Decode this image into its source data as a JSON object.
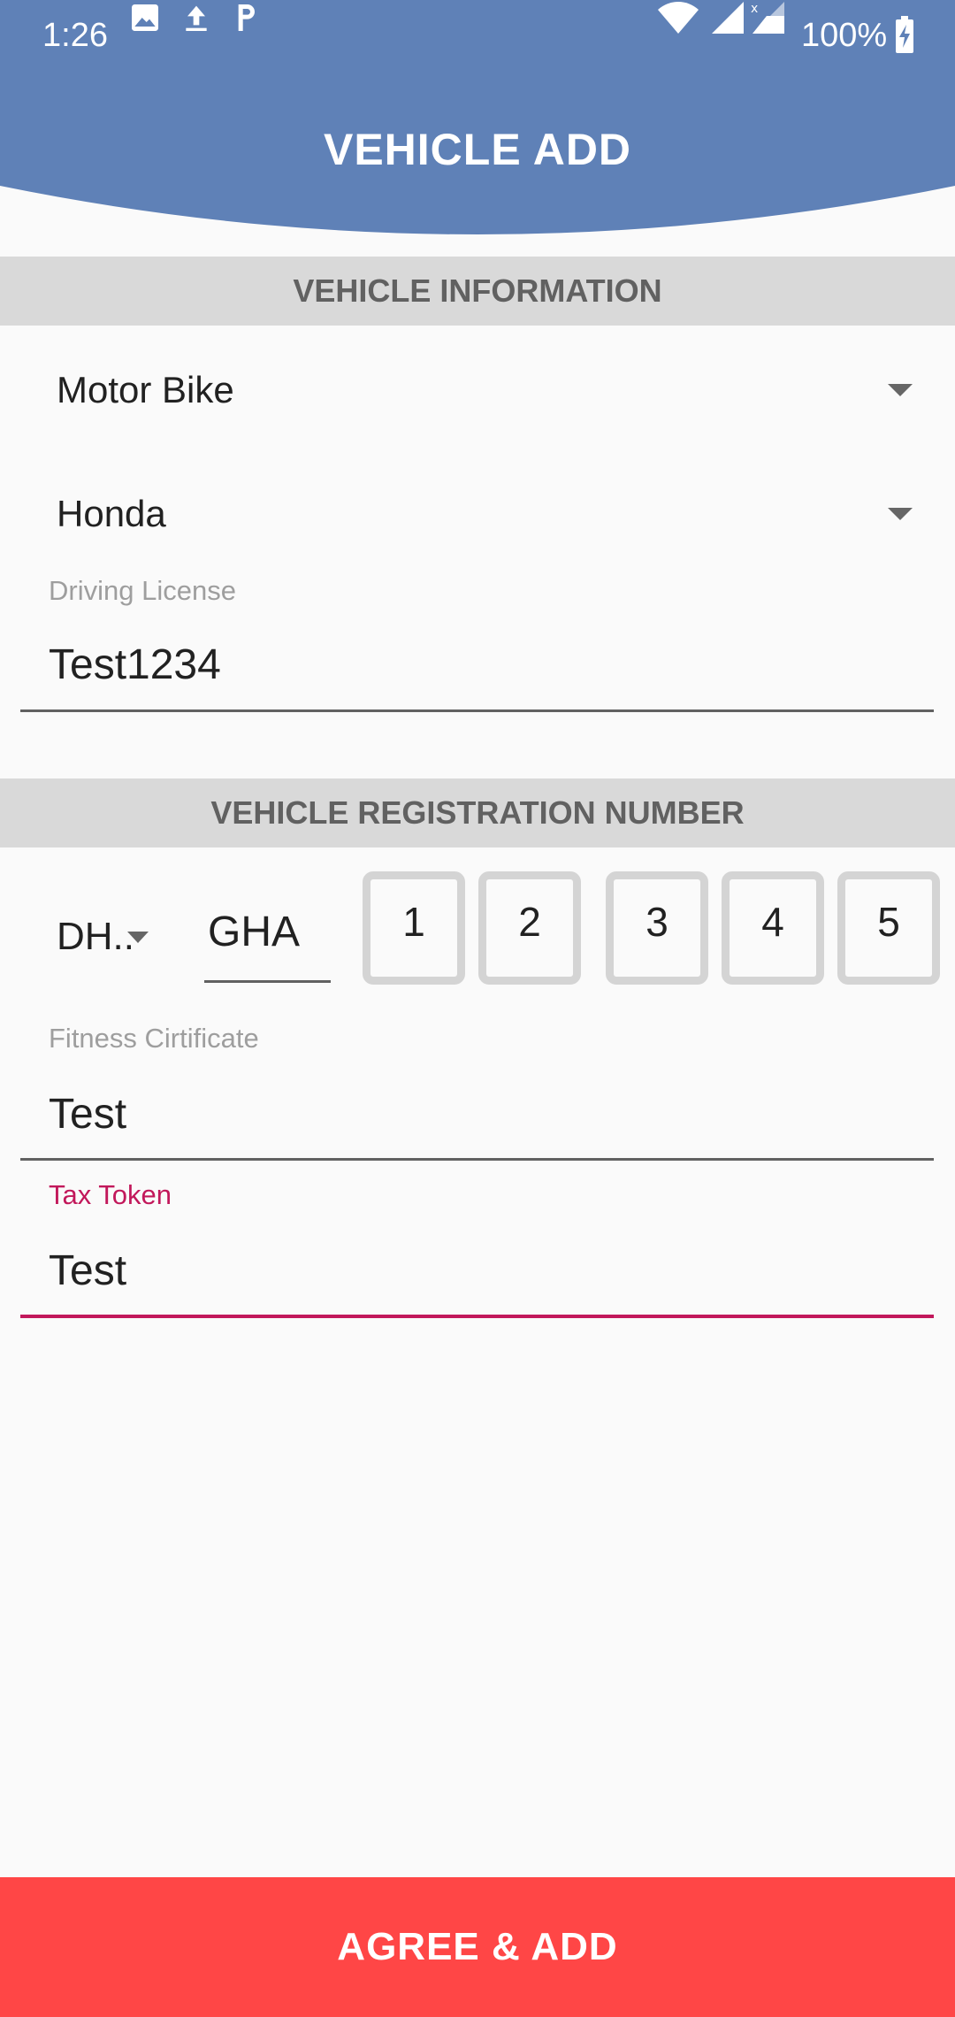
{
  "status_bar": {
    "time": "1:26",
    "battery": "100%",
    "icons": [
      "image-icon",
      "upload-icon",
      "parking-icon",
      "wifi-icon",
      "signal-icon",
      "signal-x-icon",
      "battery-charging-icon"
    ]
  },
  "header": {
    "title": "VEHICLE ADD",
    "color": "#5f81b7"
  },
  "vehicle_info": {
    "section_title": "VEHICLE INFORMATION",
    "vehicle_type": "Motor Bike",
    "vehicle_brand": "Honda",
    "driving_license": {
      "label": "Driving License",
      "value": "Test1234"
    }
  },
  "registration": {
    "section_title": "VEHICLE REGISTRATION NUMBER",
    "area": "DH..",
    "series": "GHA",
    "digits": [
      "1",
      "2",
      "3",
      "4",
      "5"
    ]
  },
  "fitness_certificate": {
    "label": "Fitness Cirtificate",
    "value": "Test"
  },
  "tax_token": {
    "label": "Tax Token",
    "value": "Test",
    "accent": "#c2185b"
  },
  "submit": {
    "label": "AGREE & ADD",
    "color": "#ff4646"
  }
}
